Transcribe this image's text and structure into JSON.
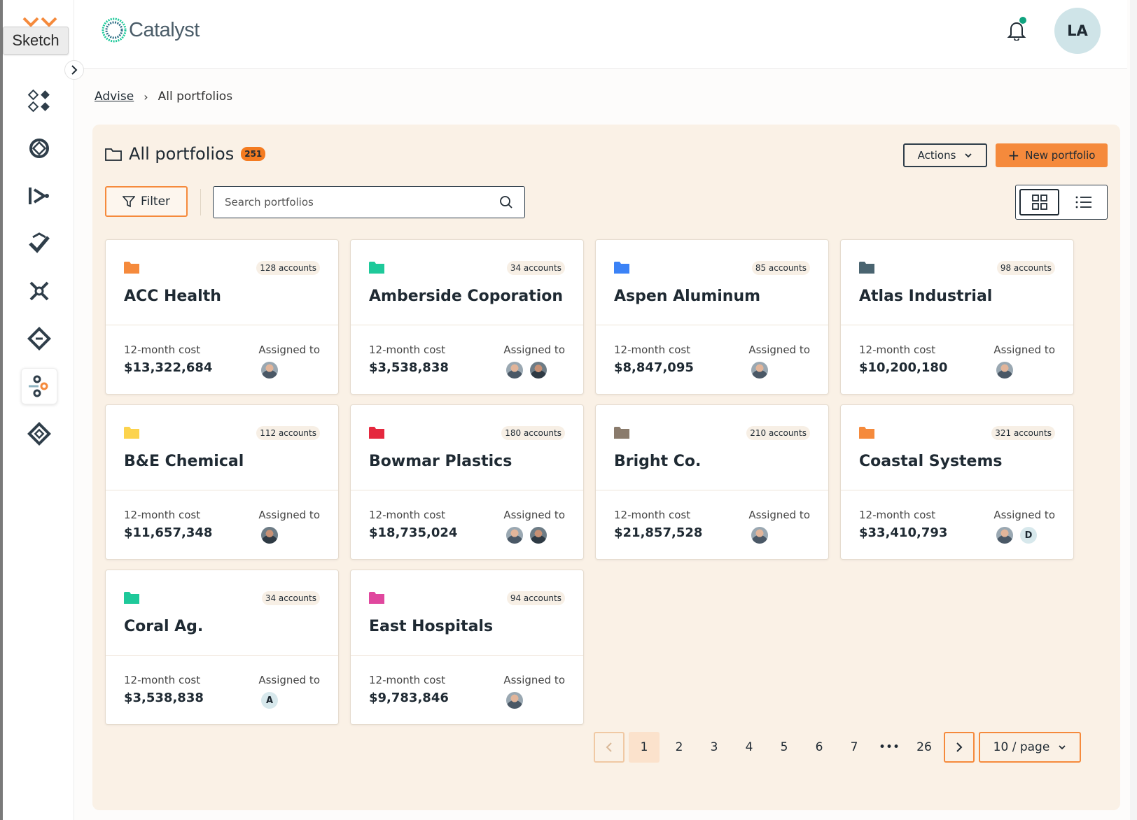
{
  "app": {
    "brand_name": "Catalyst",
    "overlay_label": "Sketch",
    "user_initials": "LA"
  },
  "breadcrumb": {
    "parent": "Advise",
    "current": "All portfolios"
  },
  "panel": {
    "title": "All portfolios",
    "count": "251",
    "actions_label": "Actions",
    "new_label": "New portfolio",
    "filter_label": "Filter",
    "search_placeholder": "Search portfolios"
  },
  "card_labels": {
    "cost": "12-month cost",
    "assigned": "Assigned to"
  },
  "colors": {
    "accent": "#f58a3c",
    "panel_bg": "#faf1e6",
    "notification": "#10a37f"
  },
  "portfolios": [
    {
      "name": "ACC Health",
      "accounts": "128 accounts",
      "cost": "$13,322,684",
      "folder_color": "#f58a3c",
      "assignees": [
        {
          "type": "photo"
        }
      ]
    },
    {
      "name": "Amberside Coporation",
      "accounts": "34 accounts",
      "cost": "$3,538,838",
      "folder_color": "#1ec99a",
      "assignees": [
        {
          "type": "photo"
        },
        {
          "type": "photo2"
        }
      ]
    },
    {
      "name": "Aspen Aluminum",
      "accounts": "85 accounts",
      "cost": "$8,847,095",
      "folder_color": "#3b82f6",
      "assignees": [
        {
          "type": "photo"
        }
      ]
    },
    {
      "name": "Atlas Industrial",
      "accounts": "98 accounts",
      "cost": "$10,200,180",
      "folder_color": "#4a6470",
      "assignees": [
        {
          "type": "photo"
        }
      ]
    },
    {
      "name": "B&E Chemical",
      "accounts": "112 accounts",
      "cost": "$11,657,348",
      "folder_color": "#fcd34d",
      "assignees": [
        {
          "type": "photo2"
        }
      ]
    },
    {
      "name": "Bowmar Plastics",
      "accounts": "180 accounts",
      "cost": "$18,735,024",
      "folder_color": "#e5283e",
      "assignees": [
        {
          "type": "photo"
        },
        {
          "type": "photo2"
        }
      ]
    },
    {
      "name": "Bright Co.",
      "accounts": "210 accounts",
      "cost": "$21,857,528",
      "folder_color": "#8a7b6c",
      "assignees": [
        {
          "type": "photo"
        }
      ]
    },
    {
      "name": "Coastal Systems",
      "accounts": "321 accounts",
      "cost": "$33,410,793",
      "folder_color": "#f58a3c",
      "assignees": [
        {
          "type": "photo"
        },
        {
          "type": "letter",
          "label": "D"
        }
      ]
    },
    {
      "name": "Coral Ag.",
      "accounts": "34 accounts",
      "cost": "$3,538,838",
      "folder_color": "#1ec99a",
      "assignees": [
        {
          "type": "letter",
          "label": "A"
        }
      ]
    },
    {
      "name": "East Hospitals",
      "accounts": "94 accounts",
      "cost": "$9,783,846",
      "folder_color": "#e0479e",
      "assignees": [
        {
          "type": "photo"
        }
      ]
    }
  ],
  "pagination": {
    "pages": [
      "1",
      "2",
      "3",
      "4",
      "5",
      "6",
      "7",
      "•••",
      "26"
    ],
    "current": "1",
    "per_page": "10 / page"
  },
  "sidebar_icons": [
    "modules-icon",
    "network-icon",
    "flow-icon",
    "check-shield-icon",
    "dna-icon",
    "diamond-icon",
    "connector-icon",
    "grid-diamond-icon"
  ],
  "sidebar_active_index": 6
}
